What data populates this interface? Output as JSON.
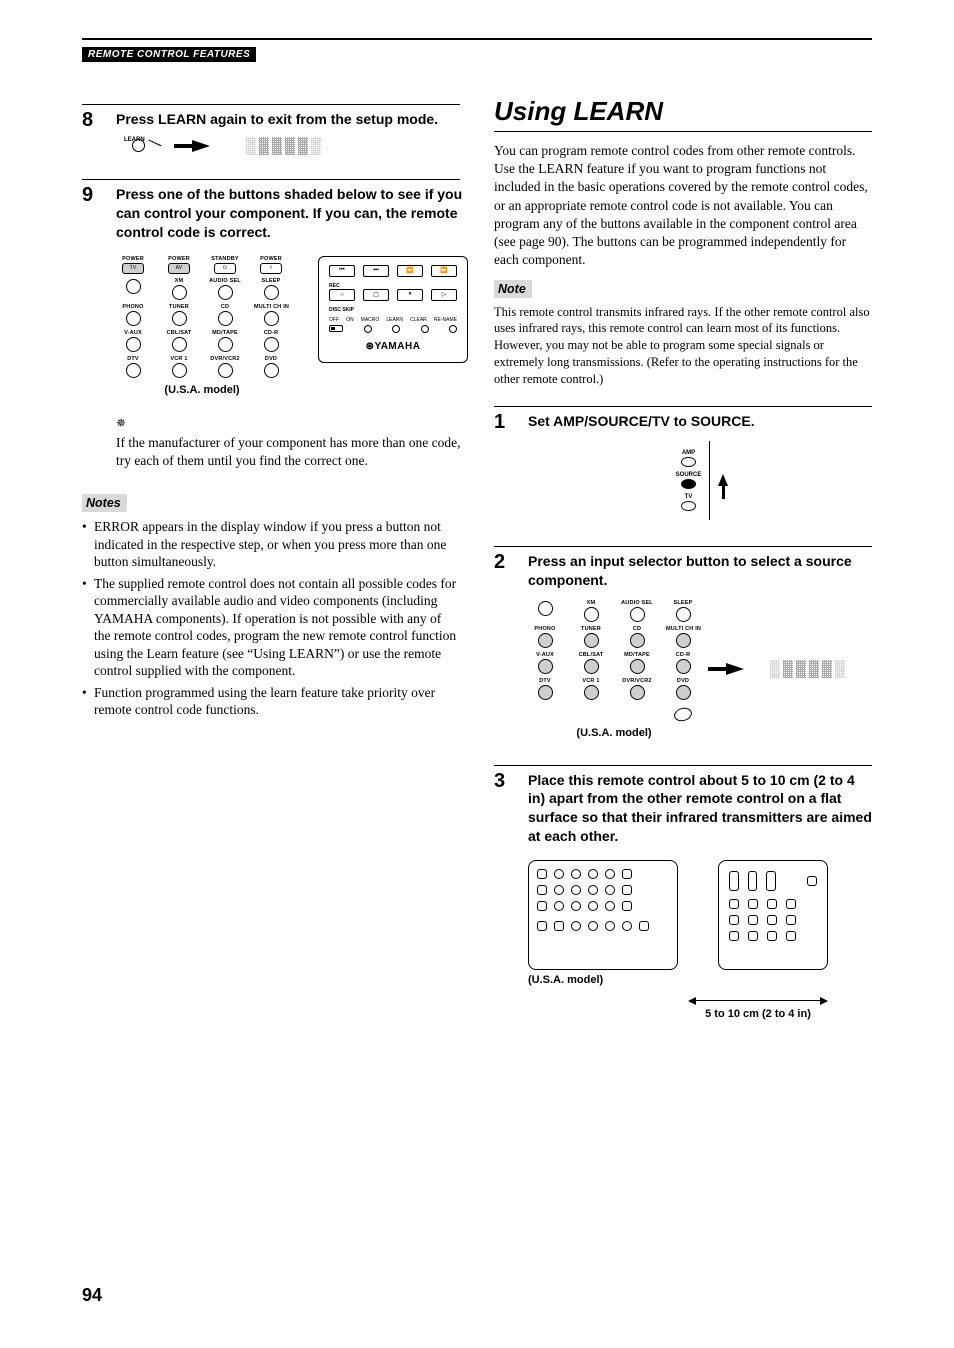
{
  "header": {
    "label": "REMOTE CONTROL FEATURES"
  },
  "page_number": "94",
  "left": {
    "step8": {
      "num": "8",
      "title": "Press LEARN again to exit from the setup mode.",
      "learn_label": "LEARN"
    },
    "step9": {
      "num": "9",
      "title": "Press one of the buttons shaded below to see if you can control your component. If you can, the remote control code is correct.",
      "grid": {
        "row1": [
          "POWER",
          "POWER",
          "STANDBY",
          "POWER"
        ],
        "row1b": [
          "TV",
          "AV",
          "",
          ""
        ],
        "row2": [
          "",
          "XM",
          "AUDIO SEL",
          "SLEEP"
        ],
        "row3": [
          "PHONO",
          "TUNER",
          "CD",
          "MULTI CH IN"
        ],
        "row4": [
          "V-AUX",
          "CBL/SAT",
          "MD/TAPE",
          "CD-R"
        ],
        "row5": [
          "DTV",
          "VCR 1",
          "DVR/VCR2",
          "DVD"
        ]
      },
      "panel": {
        "rec": "REC",
        "disc_skip": "DISC SKIP",
        "bottom": [
          "OFF",
          "ON",
          "MACRO",
          "LEARN",
          "CLEAR",
          "RE-NAME"
        ],
        "brand": "YAMAHA"
      },
      "usa_model": "(U.S.A. model)",
      "tip": "If the manufacturer of your component has more than one code, try each of them until you find the correct one."
    },
    "notes_label": "Notes",
    "notes": [
      "ERROR appears in the display window if you press a button not indicated in the respective step, or when you press more than one button simultaneously.",
      "The supplied remote control does not contain all possible codes for commercially available audio and video components (including YAMAHA components). If operation is not possible with any of the remote control codes, program the new remote control function using the Learn feature (see “Using LEARN”) or use the remote control supplied with the component.",
      "Function programmed using the learn feature take priority over remote control code functions."
    ]
  },
  "right": {
    "section_title": "Using LEARN",
    "intro": "You can program remote control codes from other remote controls. Use the LEARN feature if you want to program functions not included in the basic operations covered by the remote control codes, or an appropriate remote control code is not available. You can program any of the buttons available in the component control area (see page 90). The buttons can be programmed independently for each component.",
    "note_label": "Note",
    "note_body": "This remote control transmits infrared rays. If the other remote control also uses infrared rays, this remote control can learn most of its functions. However, you may not be able to program some special signals or extremely long transmissions. (Refer to the operating instructions for the other remote control.)",
    "step1": {
      "num": "1",
      "title": "Set AMP/SOURCE/TV to SOURCE.",
      "labels": {
        "amp": "AMP",
        "source": "SOURCE",
        "tv": "TV"
      }
    },
    "step2": {
      "num": "2",
      "title": "Press an input selector button to select a source component.",
      "grid": {
        "row1": [
          "",
          "XM",
          "AUDIO SEL",
          "SLEEP"
        ],
        "row2": [
          "PHONO",
          "TUNER",
          "CD",
          "MULTI CH IN"
        ],
        "row3": [
          "V-AUX",
          "CBL/SAT",
          "MD/TAPE",
          "CD-R"
        ],
        "row4": [
          "DTV",
          "VCR 1",
          "DVR/VCR2",
          "DVD"
        ]
      },
      "usa_model": "(U.S.A. model)"
    },
    "step3": {
      "num": "3",
      "title": "Place this remote control about 5 to 10 cm (2 to 4 in) apart from the other remote control on a flat surface so that their infrared transmitters are aimed at each other.",
      "usa_model": "(U.S.A. model)",
      "distance": "5 to 10 cm (2 to 4 in)"
    }
  }
}
